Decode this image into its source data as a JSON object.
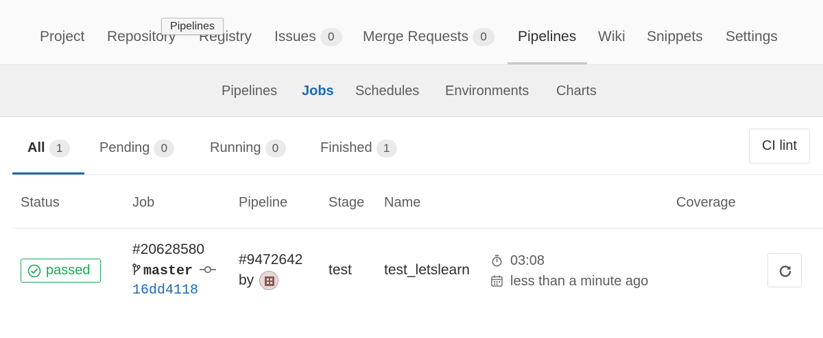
{
  "top_nav": {
    "items": [
      {
        "label": "Project"
      },
      {
        "label": "Repository"
      },
      {
        "label": "Registry"
      },
      {
        "label": "Issues",
        "count": "0"
      },
      {
        "label": "Merge Requests",
        "count": "0"
      },
      {
        "label": "Pipelines"
      },
      {
        "label": "Wiki"
      },
      {
        "label": "Snippets"
      },
      {
        "label": "Settings"
      }
    ],
    "active": "Pipelines"
  },
  "tooltip": {
    "text": "Pipelines"
  },
  "sub_nav": {
    "items": [
      {
        "label": "Pipelines"
      },
      {
        "label": "Jobs"
      },
      {
        "label": "Schedules"
      },
      {
        "label": "Environments"
      },
      {
        "label": "Charts"
      }
    ],
    "active": "Jobs"
  },
  "tabs": [
    {
      "label": "All",
      "count": "1"
    },
    {
      "label": "Pending",
      "count": "0"
    },
    {
      "label": "Running",
      "count": "0"
    },
    {
      "label": "Finished",
      "count": "1"
    }
  ],
  "active_tab": "All",
  "ci_lint_label": "CI lint",
  "table": {
    "headers": [
      "Status",
      "Job",
      "Pipeline",
      "Stage",
      "Name",
      "Coverage"
    ],
    "rows": [
      {
        "status": "passed",
        "job_id": "#20628580",
        "branch": "master",
        "commit": "16dd4118",
        "pipeline_id": "#9472642",
        "pipeline_by": "by",
        "stage": "test",
        "name": "test_letslearn",
        "duration": "03:08",
        "finished": "less than a minute ago"
      }
    ]
  },
  "colors": {
    "success": "#1aaa55",
    "link": "#1b69b6",
    "active_tab_underline": "#1b69b6"
  },
  "icons": {
    "status": "check-circle-icon",
    "branch": "branch-icon",
    "commit": "commit-icon",
    "duration": "timer-icon",
    "finished": "calendar-icon",
    "retry": "retry-icon"
  }
}
